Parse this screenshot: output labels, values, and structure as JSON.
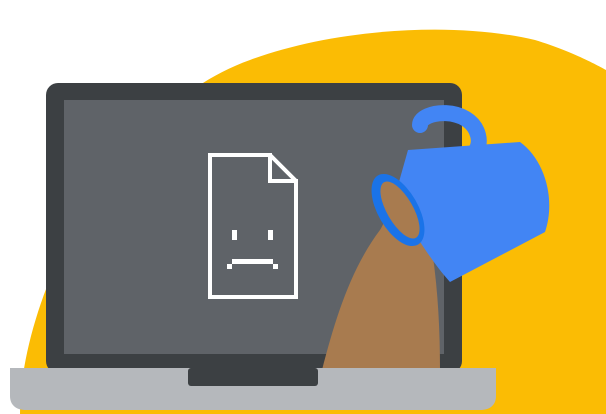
{
  "illustration": {
    "subject": "broken-page-illustration",
    "icons": [
      "sad-page-icon",
      "mug-icon"
    ],
    "colors": {
      "background": "#FFFFFF",
      "sun_blob": "#FBBC04",
      "laptop_bezel": "#3C4043",
      "laptop_screen": "#5F6368",
      "laptop_base": "#B5B8BC",
      "laptop_notch": "#3C4043",
      "page_icon_stroke": "#FFFFFF",
      "mug": "#4285F4",
      "mug_shadow": "#1A73E8",
      "coffee": "#A87B4F"
    }
  }
}
